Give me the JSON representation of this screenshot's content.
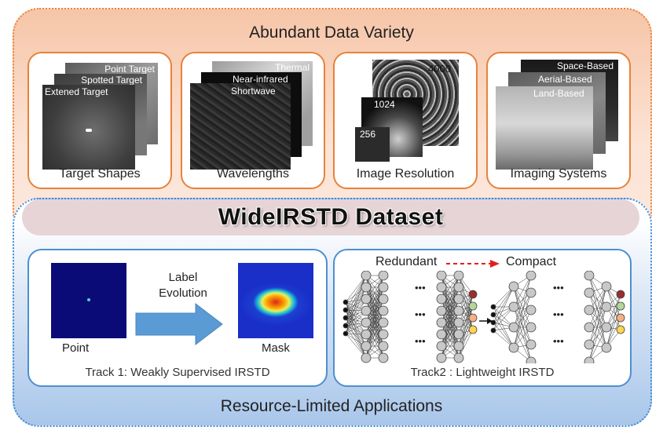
{
  "top": {
    "title": "Abundant Data Variety"
  },
  "banner": {
    "title": "WideIRSTD Dataset"
  },
  "bottom": {
    "title": "Resource-Limited Applications"
  },
  "cards": {
    "target_shapes": {
      "label": "Target Shapes",
      "layers": [
        "Point Target",
        "Spotted Target",
        "Extened Target"
      ]
    },
    "wavelengths": {
      "label": "Wavelengths",
      "layers": [
        "Thermal",
        "Near-infrared",
        "Shortwave"
      ]
    },
    "resolution": {
      "label": "Image Resolution",
      "layers": [
        "4000",
        "1024",
        "256"
      ]
    },
    "imaging": {
      "label": "Imaging  Systems",
      "layers": [
        "Space-Based",
        "Aerial-Based",
        "Land-Based"
      ]
    }
  },
  "track1": {
    "label": "Track 1: Weakly Supervised IRSTD",
    "arrow_label_line1": "Label",
    "arrow_label_line2": "Evolution",
    "left_caption": "Point",
    "right_caption": "Mask"
  },
  "track2": {
    "label": "Track2 : Lightweight IRSTD",
    "left_title": "Redundant",
    "right_title": "Compact",
    "ellipsis": "•••"
  },
  "colors": {
    "top_border": "#e8823a",
    "bottom_border": "#3a8ad6",
    "arrow_blue": "#5b9bd5",
    "red_dashed_arrow": "#e02020",
    "output_nodes": [
      "#9b2d2d",
      "#b5d69a",
      "#f4b183",
      "#ffd54f"
    ]
  }
}
